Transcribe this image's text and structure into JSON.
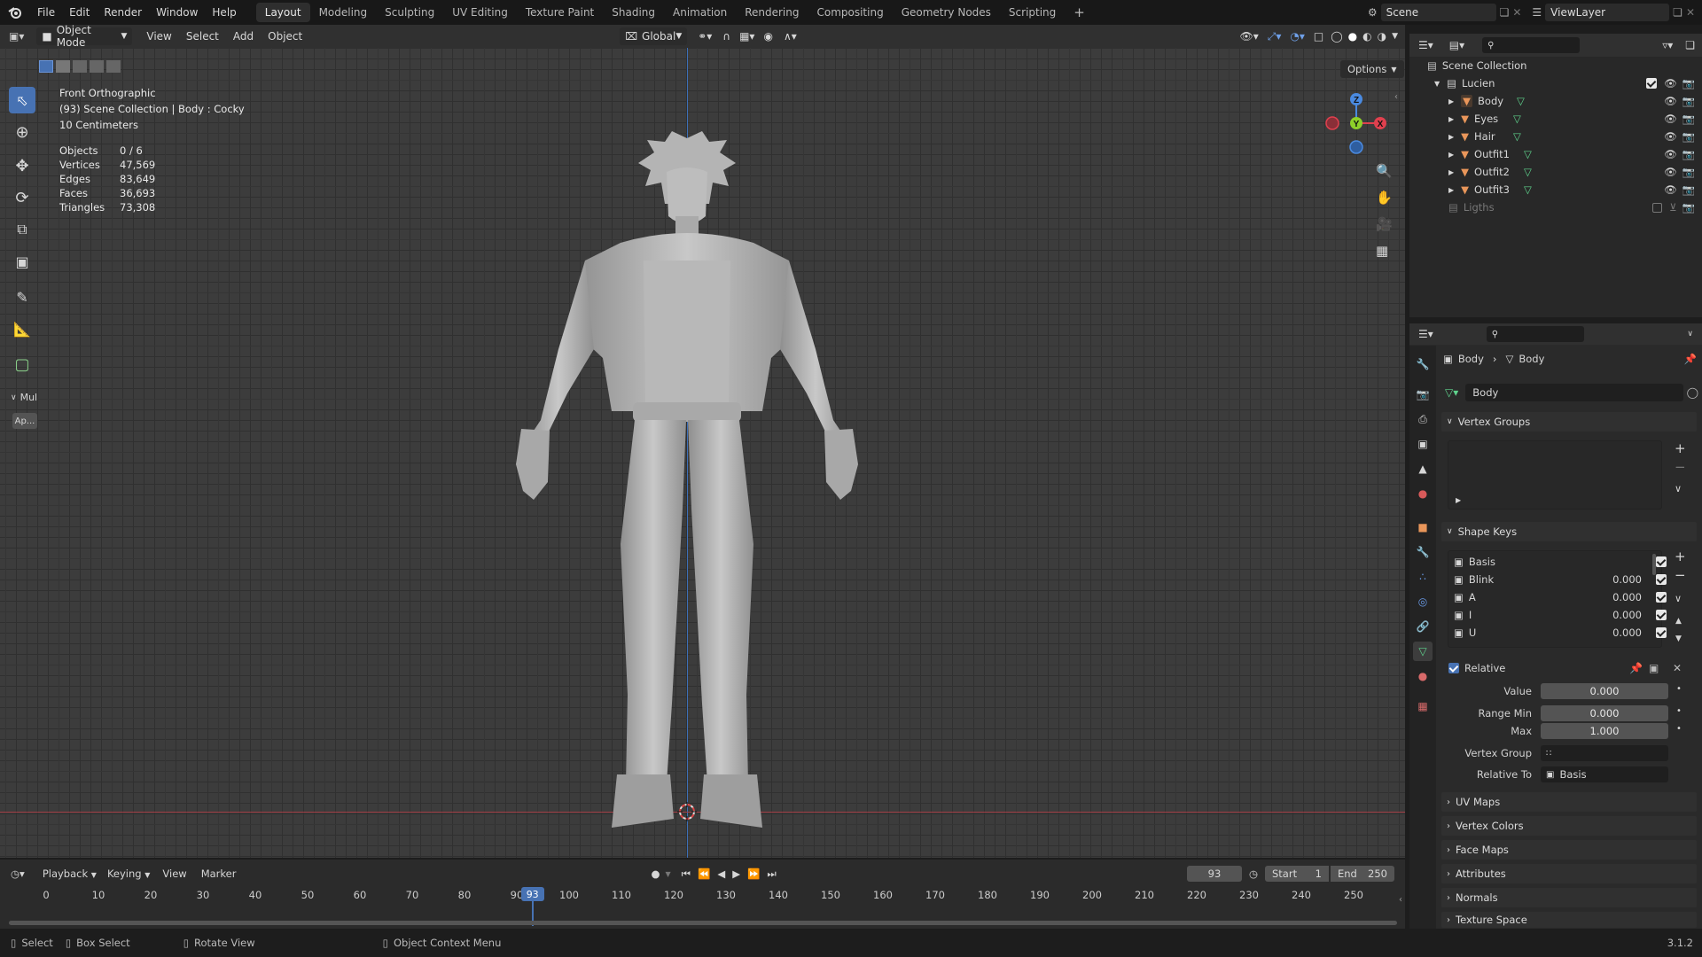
{
  "topbar": {
    "menus": [
      "File",
      "Edit",
      "Render",
      "Window",
      "Help"
    ],
    "workspaces": [
      "Layout",
      "Modeling",
      "Sculpting",
      "UV Editing",
      "Texture Paint",
      "Shading",
      "Animation",
      "Rendering",
      "Compositing",
      "Geometry Nodes",
      "Scripting"
    ],
    "active_workspace": "Layout",
    "scene": "Scene",
    "view_layer": "ViewLayer"
  },
  "viewport_header": {
    "mode": "Object Mode",
    "menus": [
      "View",
      "Select",
      "Add",
      "Object"
    ],
    "transform_orientation": "Global",
    "options": "Options"
  },
  "overlay": {
    "view_name": "Front Orthographic",
    "context": "(93) Scene Collection | Body : Cocky",
    "scale": "10 Centimeters",
    "stats": [
      {
        "label": "Objects",
        "value": "0 / 6"
      },
      {
        "label": "Vertices",
        "value": "47,569"
      },
      {
        "label": "Edges",
        "value": "83,649"
      },
      {
        "label": "Faces",
        "value": "36,693"
      },
      {
        "label": "Triangles",
        "value": "73,308"
      }
    ]
  },
  "gizmo": {
    "z": "Z",
    "y": "Y",
    "x": "X"
  },
  "toolbar": {
    "collapsed_panel": "Mul",
    "apply_button": "Ap..."
  },
  "outliner": {
    "root": "Scene Collection",
    "collection": "Lucien",
    "objects": [
      "Body",
      "Eyes",
      "Hair",
      "Outfit1",
      "Outfit2",
      "Outfit3"
    ],
    "hidden_collection": "Ligths"
  },
  "properties": {
    "breadcrumb_object": "Body",
    "breadcrumb_data": "Body",
    "mesh_name": "Body",
    "vertex_groups_title": "Vertex Groups",
    "shape_keys_title": "Shape Keys",
    "shape_keys": [
      {
        "name": "Basis",
        "value": ""
      },
      {
        "name": "Blink",
        "value": "0.000"
      },
      {
        "name": "A",
        "value": "0.000"
      },
      {
        "name": "I",
        "value": "0.000"
      },
      {
        "name": "U",
        "value": "0.000"
      }
    ],
    "relative_label": "Relative",
    "value_label": "Value",
    "value": "0.000",
    "range_min_label": "Range Min",
    "range_min": "0.000",
    "max_label": "Max",
    "max": "1.000",
    "vertex_group_label": "Vertex Group",
    "relative_to_label": "Relative To",
    "relative_to": "Basis",
    "collapsed_panels": [
      "UV Maps",
      "Vertex Colors",
      "Face Maps",
      "Attributes",
      "Normals",
      "Texture Space"
    ]
  },
  "timeline": {
    "menus": [
      "Playback",
      "Keying",
      "View",
      "Marker"
    ],
    "current_frame": "93",
    "start_label": "Start",
    "start": "1",
    "end_label": "End",
    "end": "250",
    "ticks": [
      "0",
      "10",
      "20",
      "30",
      "40",
      "50",
      "60",
      "70",
      "80",
      "90",
      "100",
      "110",
      "120",
      "130",
      "140",
      "150",
      "160",
      "170",
      "180",
      "190",
      "200",
      "210",
      "220",
      "230",
      "240",
      "250"
    ]
  },
  "statusbar": {
    "select": "Select",
    "box_select": "Box Select",
    "rotate_view": "Rotate View",
    "context_menu": "Object Context Menu",
    "version": "3.1.2"
  },
  "colors": {
    "accent": "#4772b3",
    "x_axis": "#e0404e",
    "y_axis": "#8ed02a",
    "z_axis": "#4a8ae0",
    "object_orange": "#e9965a",
    "mesh_green": "#5fd38d"
  }
}
